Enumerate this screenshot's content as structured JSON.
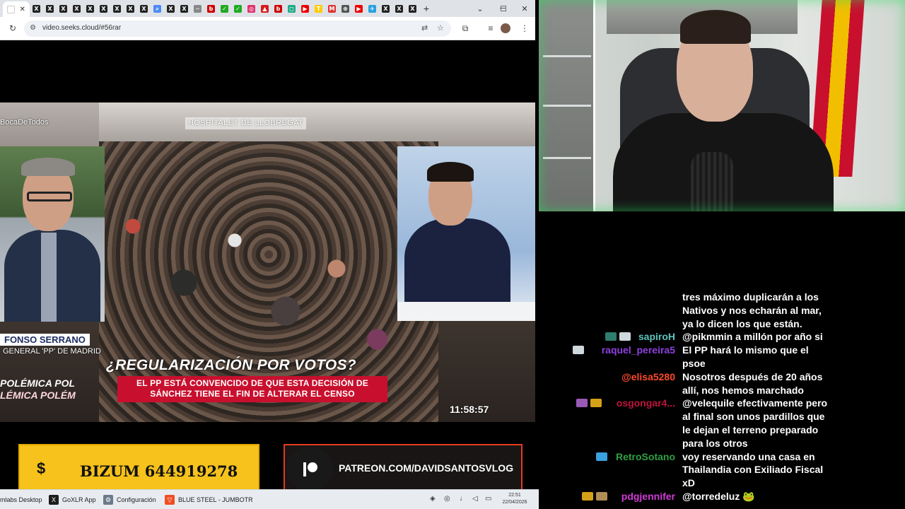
{
  "browser": {
    "tabs_count_label": "",
    "url": "video.seeks.cloud/#56rar"
  },
  "video": {
    "watermark": "BocaDeTodos",
    "location": "HOSPITALET DE LLOBREGAT",
    "lower_third_name": "FONSO SERRANO",
    "lower_third_role": "GENERAL 'PP' DE MADRID",
    "headline": "¿REGULARIZACIÓN POR VOTOS?",
    "subhead_line1": "EL PP ESTÁ CONVENCIDO DE QUE ESTA DECISIÓN DE",
    "subhead_line2": "SÁNCHEZ TIENE EL FIN DE ALTERAR EL CENSO",
    "ticker_line1": "POLÉMICA   POL",
    "ticker_line2": "LÉMICA   POLÉM",
    "clock": "11:58:57"
  },
  "banners": {
    "bizum_symbol": "$",
    "bizum_text": "BIZUM 644919278",
    "patreon_text": "PATREON.COM/DAVIDSANTOSVLOG"
  },
  "taskbar": {
    "items": [
      {
        "label": "mlabs Desktop"
      },
      {
        "label": "GoXLR App"
      },
      {
        "label": "Configuración"
      },
      {
        "label": "BLUE STEEL - JUMBOTR"
      }
    ],
    "time": "22:51",
    "date": "22/04/2026"
  },
  "chat": {
    "messages": [
      {
        "user": "",
        "color": "#ffffff",
        "lines": [
          "tres máximo duplicarán a los",
          "Nativos y nos echarán al mar,",
          "ya lo dicen los que están."
        ]
      },
      {
        "user": "sapiroH",
        "color": "#5ec4c0",
        "lines": [
          "@pikmmin a millón por año si"
        ]
      },
      {
        "user": "raquel_pereira5",
        "color": "#8e3fe0",
        "lines": [
          "El PP hará lo mismo que el",
          "psoe"
        ]
      },
      {
        "user": "@elisa5280",
        "color": "#ff4a2a",
        "lines": [
          "Nosotros después de 20 años",
          "allí, nos hemos marchado"
        ]
      },
      {
        "user": "osgongar4...",
        "color": "#c0143c",
        "lines": [
          "@velequile efectivamente pero",
          "al final son unos pardillos que",
          "le dejan el terreno preparado",
          "para los otros"
        ]
      },
      {
        "user": "RetroSotano",
        "color": "#2ea043",
        "lines": [
          "voy reservando una casa en",
          "Thailandia con Exiliado Fiscal",
          "xD"
        ]
      },
      {
        "user": "pdgjennifer",
        "color": "#d23bd6",
        "lines": [
          "@torredeluz 🐸"
        ]
      }
    ]
  }
}
